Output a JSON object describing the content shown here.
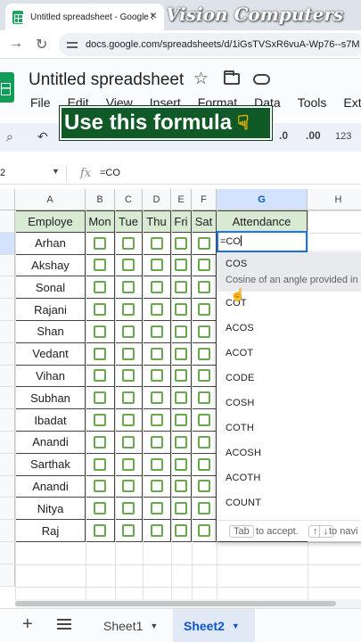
{
  "browser": {
    "tab_title": "Untitled spreadsheet - Google S",
    "url": "docs.google.com/spreadsheets/d/1iGsTVSxR6vuA-Wp76--s7M"
  },
  "watermark": "Vision Computers",
  "app": {
    "title": "Untitled spreadsheet",
    "menu": [
      "File",
      "Edit",
      "View",
      "Insert",
      "Format",
      "Data",
      "Tools",
      "Exten"
    ]
  },
  "banner": "Use this formula",
  "toolbar": {
    "dec_decrease": ".0",
    "dec_increase": ".00",
    "format_number": "123"
  },
  "formula_bar": {
    "name_box": "2",
    "value": "=CO"
  },
  "columns": [
    "A",
    "B",
    "C",
    "D",
    "E",
    "F",
    "G",
    "H"
  ],
  "table": {
    "headers": [
      "Employe",
      "Mon",
      "Tue",
      "Thu",
      "Fri",
      "Sat",
      "Attendance"
    ],
    "names": [
      "Arhan",
      "Akshay",
      "Sonal",
      "Rajani",
      "Shan",
      "Vedant",
      "Vihan",
      "Subhan",
      "Ibadat",
      "Anandi",
      "Sarthak",
      "Anandi",
      "Nitya",
      "Raj"
    ]
  },
  "editing_cell": "=CO",
  "autocomplete": {
    "selected": "COS",
    "selected_desc": "Cosine of an angle provided in",
    "items": [
      "COT",
      "ACOS",
      "ACOT",
      "CODE",
      "COSH",
      "COTH",
      "ACOSH",
      "ACOTH",
      "COUNT"
    ],
    "footer_key": "Tab",
    "footer_text": "to accept.",
    "footer_nav": "to navi"
  },
  "sheets": [
    {
      "label": "Sheet1",
      "active": false
    },
    {
      "label": "Sheet2",
      "active": true
    }
  ],
  "colors": {
    "header_fill": "#d9ead3",
    "checkbox": "#6aa84f",
    "banner": "#0f5a26",
    "selection": "#1a73e8"
  }
}
